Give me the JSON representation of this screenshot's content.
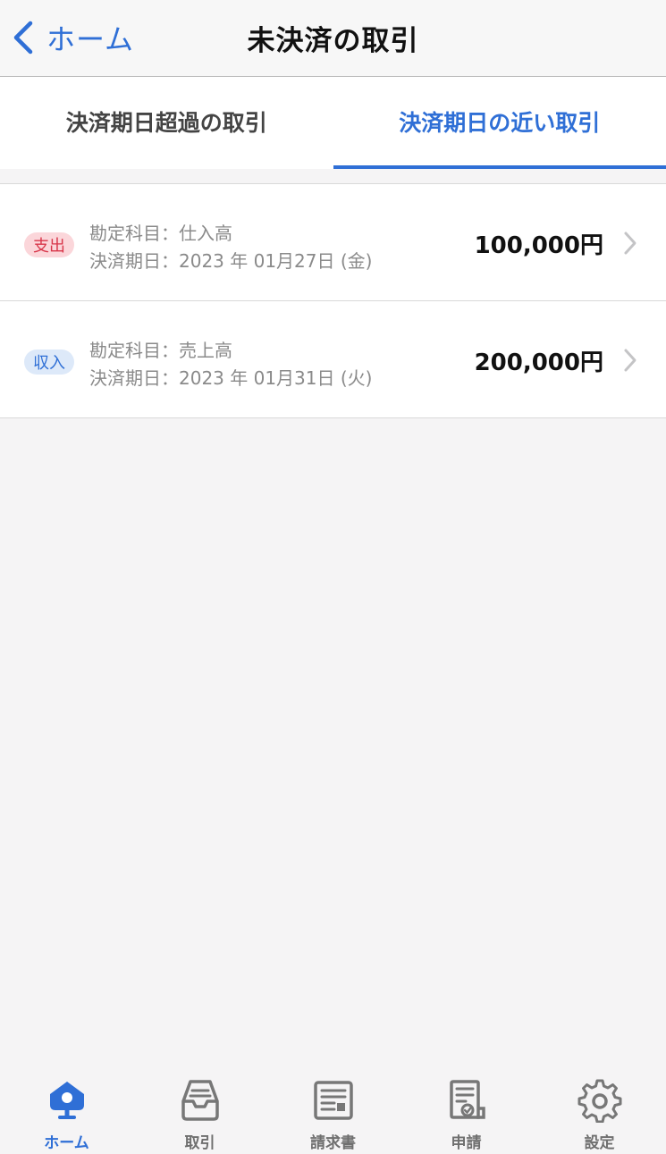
{
  "navbar": {
    "back_label": "ホーム",
    "title": "未決済の取引"
  },
  "tabs": [
    {
      "label": "決済期日超過の取引",
      "active": false
    },
    {
      "label": "決済期日の近い取引",
      "active": true
    }
  ],
  "transactions": [
    {
      "type": "支出",
      "account": "勘定科目：仕入高",
      "due": "決済期日：2023 年 01月27日 (金)",
      "amount": "100,000円"
    },
    {
      "type": "収入",
      "account": "勘定科目：売上高",
      "due": "決済期日：2023 年 01月31日 (火)",
      "amount": "200,000円"
    }
  ],
  "tabbar": [
    {
      "label": "ホーム",
      "icon": "home-icon",
      "active": true
    },
    {
      "label": "取引",
      "icon": "tray-icon",
      "active": false
    },
    {
      "label": "請求書",
      "icon": "invoice-icon",
      "active": false
    },
    {
      "label": "申請",
      "icon": "application-icon",
      "active": false
    },
    {
      "label": "設定",
      "icon": "gear-icon",
      "active": false
    }
  ],
  "colors": {
    "accent": "#2f6fd6",
    "expense_badge_bg": "#fbd6da",
    "expense_badge_text": "#d8364a",
    "income_badge_bg": "#dde9f9"
  }
}
